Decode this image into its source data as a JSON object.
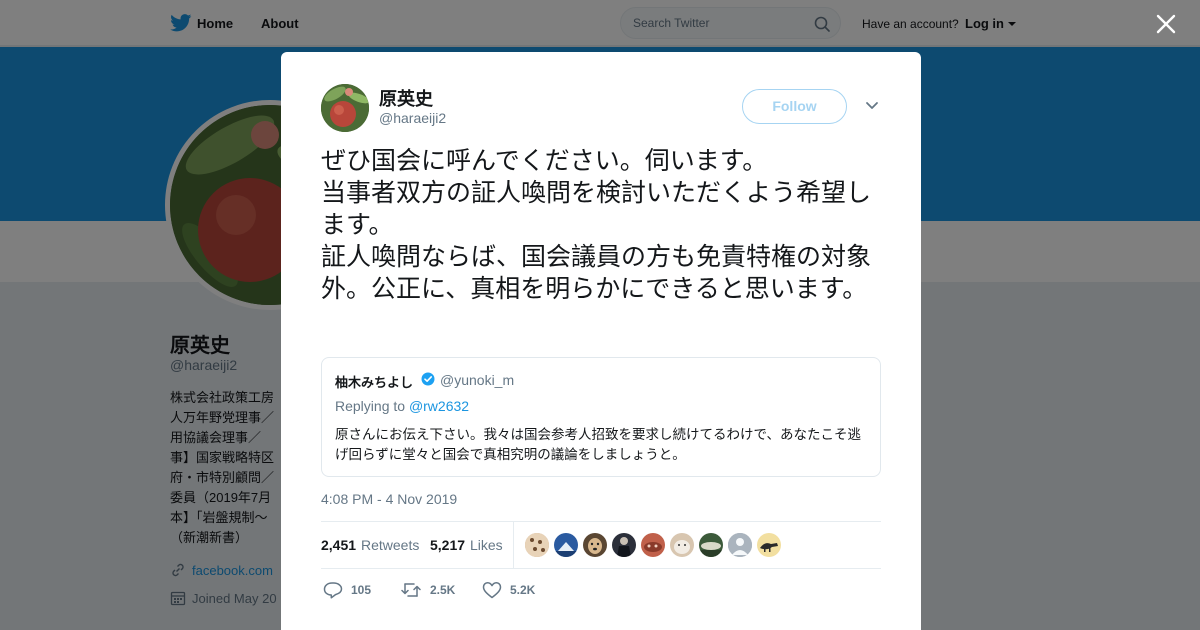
{
  "nav": {
    "home": "Home",
    "about": "About",
    "search_placeholder": "Search Twitter",
    "have_account": "Have an account?",
    "login": "Log in"
  },
  "profile": {
    "name": "原英史",
    "handle": "@haraeiji2",
    "bio": "株式会社政策工房\n人万年野党理事／\n用協議会理事／\n事】国家戦略特区\n府・市特別顧問／\n委員（2019年7月\n本】「岩盤規制～\n（新潮新書）",
    "link": "facebook.com",
    "joined": "Joined May 20"
  },
  "tweet": {
    "author_name": "原英史",
    "author_handle": "@haraeiji2",
    "follow_label": "Follow",
    "text": "ぜひ国会に呼んでください。伺います。\n当事者双方の証人喚問を検討いただくよう希望します。\n証人喚問ならば、国会議員の方も免責特権の対象外。公正に、真相を明らかにできると思います。",
    "timestamp": "4:08 PM - 4 Nov 2019",
    "retweets_count": "2,451",
    "retweets_label": "Retweets",
    "likes_count": "5,217",
    "likes_label": "Likes",
    "reply_short": "105",
    "retweet_short": "2.5K",
    "like_short": "5.2K"
  },
  "quoted": {
    "name": "柚木みちよし",
    "handle": "@yunoki_m",
    "replying_prefix": "Replying to",
    "replying_to": "@rw2632",
    "text": "原さんにお伝え下さい。我々は国会参考人招致を要求し続けてるわけで、あなたこそ逃げ回らずに堂々と国会で真相究明の議論をしましょうと。"
  },
  "colors": {
    "brand_blue": "#1b95e0",
    "follow_border": "#a6d4f2",
    "muted_text": "#657786"
  },
  "icons": {
    "logo": "twitter-bird-icon",
    "search": "search-icon",
    "close": "close-icon",
    "chevron": "chevron-down-icon",
    "verified": "verified-badge-icon",
    "reply": "reply-icon",
    "retweet": "retweet-icon",
    "like": "heart-icon",
    "link": "link-icon",
    "calendar": "calendar-icon"
  }
}
